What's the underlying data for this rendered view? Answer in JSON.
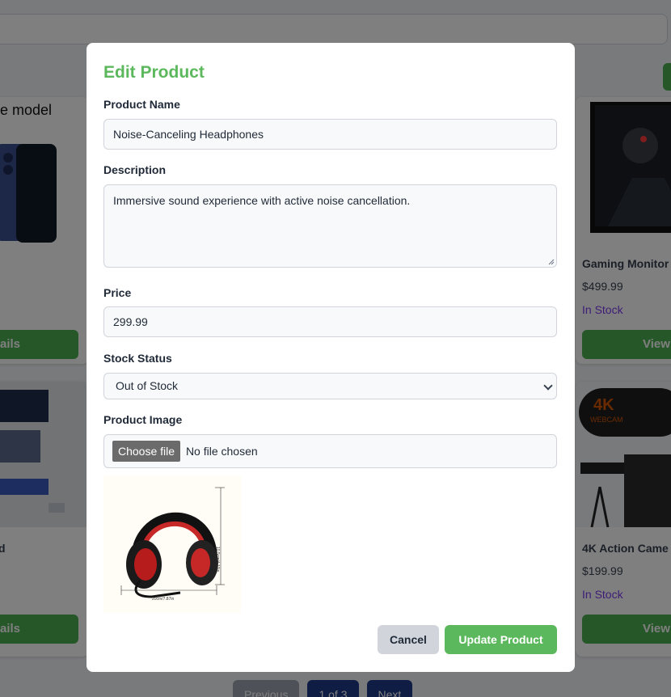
{
  "background": {
    "cards": [
      {
        "title": "e model",
        "btn": "ails"
      },
      {
        "title": "Gaming Monitor",
        "price": "$499.99",
        "stock": "In Stock",
        "btn": "View"
      },
      {
        "title": "d",
        "btn": "ails"
      },
      {
        "title": "4K Action Came",
        "price": "$199.99",
        "stock": "In Stock",
        "btn": "View"
      }
    ],
    "pagination": {
      "previous": "Previous",
      "page": "1 of 3",
      "next": "Next"
    },
    "webcam_badge": {
      "big": "4K",
      "small": "WEBCAM"
    }
  },
  "modal": {
    "title": "Edit Product",
    "name_label": "Product Name",
    "name_value": "Noise-Canceling Headphones",
    "description_label": "Description",
    "description_value": "Immersive sound experience with active noise cancellation.",
    "price_label": "Price",
    "price_value": "299.99",
    "stock_label": "Stock Status",
    "stock_value": "Out of Stock",
    "image_label": "Product Image",
    "choose_file": "Choose file",
    "no_file": "No file chosen",
    "preview_dims": {
      "height": "10.5cm/4.13in",
      "width": "20cm/7.87in"
    },
    "cancel": "Cancel",
    "update": "Update Product"
  },
  "colors": {
    "accent": "#5cb85c",
    "button_green": "#4caf50",
    "stock_purple": "#7c3aed",
    "pagination_blue": "#1e3a8a"
  }
}
